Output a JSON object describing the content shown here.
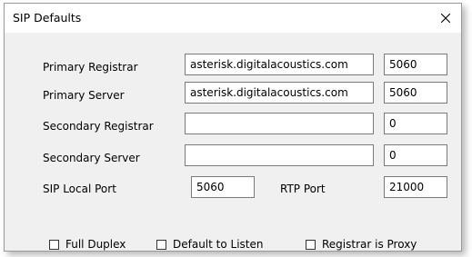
{
  "window": {
    "title": "SIP Defaults",
    "close_icon": "close-icon"
  },
  "form": {
    "primary_registrar": {
      "label": "Primary Registrar",
      "host": "asterisk.digitalacoustics.com",
      "port": "5060"
    },
    "primary_server": {
      "label": "Primary Server",
      "host": "asterisk.digitalacoustics.com",
      "port": "5060"
    },
    "secondary_registrar": {
      "label": "Secondary Registrar",
      "host": "",
      "port": "0"
    },
    "secondary_server": {
      "label": "Secondary Server",
      "host": "",
      "port": "0"
    },
    "sip_local_port": {
      "label": "SIP Local Port",
      "value": "5060"
    },
    "rtp_port": {
      "label": "RTP Port",
      "value": "21000"
    }
  },
  "options": {
    "full_duplex": {
      "label": "Full Duplex",
      "checked": false
    },
    "default_to_listen": {
      "label": "Default to Listen",
      "checked": false
    },
    "registrar_is_proxy": {
      "label": "Registrar is Proxy",
      "checked": false
    }
  }
}
